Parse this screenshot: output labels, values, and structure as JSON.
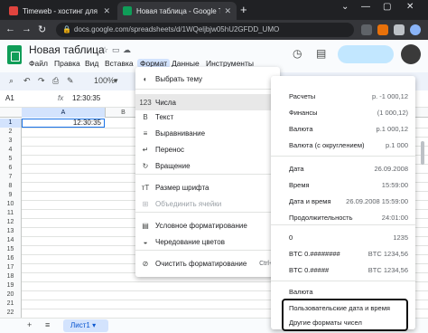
{
  "browser": {
    "tabs": [
      {
        "title": "Timeweb - хостинг для сайтов",
        "icon_color": "#e0443e"
      },
      {
        "title": "Новая таблица - Google Табли",
        "icon_color": "#0f9d58"
      }
    ],
    "url": "docs.google.com/spreadsheets/d/1WQelibj...w05hU...UMO...",
    "url_display": "docs.google.com/spreadsheets/d/1WQeljbjw05hU2GFDD_UMO",
    "close_glyph": "✕",
    "newtab_glyph": "+",
    "window": {
      "minimize": "—",
      "maximize": "▢",
      "close": "✕",
      "dropdown": "⌄"
    }
  },
  "sheets": {
    "title": "Новая таблица",
    "menus": [
      "Файл",
      "Правка",
      "Вид",
      "Вставка",
      "Формат",
      "Данные",
      "Инструменты"
    ],
    "active_menu_index": 4,
    "toolbar": {
      "zoom": "100%"
    },
    "name_box": "A1",
    "fx": "fx",
    "formula_value": "12:30:35",
    "cell_a1": "12:30:35",
    "col_a": "A",
    "col_b": "B",
    "rows": [
      "1",
      "2",
      "3",
      "4",
      "5",
      "6",
      "7",
      "8",
      "9",
      "10",
      "11",
      "12",
      "13",
      "14",
      "15",
      "16",
      "17",
      "18",
      "19",
      "20",
      "21",
      "22"
    ]
  },
  "format_menu": {
    "items": [
      {
        "label": "Выбрать тему",
        "icon": "palette-icon",
        "glyph": "◐"
      },
      {
        "label": "Числа",
        "icon": "numbers-icon",
        "glyph": "123"
      },
      {
        "label": "Текст",
        "icon": "bold-icon",
        "glyph": "B"
      },
      {
        "label": "Выравнивание",
        "icon": "align-icon",
        "glyph": "≡"
      },
      {
        "label": "Перенос",
        "icon": "wrap-icon",
        "glyph": "↵"
      },
      {
        "label": "Вращение",
        "icon": "rotate-icon",
        "glyph": "↻"
      },
      {
        "label": "Размер шрифта",
        "icon": "font-size-icon",
        "glyph": "тТ"
      },
      {
        "label": "Объединить ячейки",
        "icon": "merge-icon",
        "glyph": "⊞"
      },
      {
        "label": "Условное форматирование",
        "icon": "conditional-format-icon",
        "glyph": "▤"
      },
      {
        "label": "Чередование цветов",
        "icon": "alternating-colors-icon",
        "glyph": "◒"
      },
      {
        "label": "Очистить форматирование",
        "icon": "clear-format-icon",
        "glyph": "⊘",
        "key": "Ctrl+\\"
      }
    ]
  },
  "number_submenu": {
    "items": [
      {
        "label": "Расчеты",
        "value": "р. -1 000,12"
      },
      {
        "label": "Финансы",
        "value": "(1 000,12)"
      },
      {
        "label": "Валюта",
        "value": "р.1 000,12"
      },
      {
        "label": "Валюта (с округлением)",
        "value": "р.1 000"
      },
      {
        "label": "Дата",
        "value": "26.09.2008"
      },
      {
        "label": "Время",
        "value": "15:59:00"
      },
      {
        "label": "Дата и время",
        "value": "26.09.2008 15:59:00"
      },
      {
        "label": "Продолжительность",
        "value": "24:01:00"
      },
      {
        "label": "0",
        "value": "1235"
      },
      {
        "label": "BTC 0.########",
        "value": "BTC 1234,56"
      },
      {
        "label": "BTC 0.#####",
        "value": "BTC 1234,56"
      },
      {
        "label": "Валюта",
        "value": ""
      },
      {
        "label": "Пользовательские дата и время",
        "value": ""
      },
      {
        "label": "Другие форматы чисел",
        "value": ""
      }
    ]
  },
  "sheet_tabs": {
    "active": "Лист1",
    "add": "+",
    "all": "≡"
  }
}
